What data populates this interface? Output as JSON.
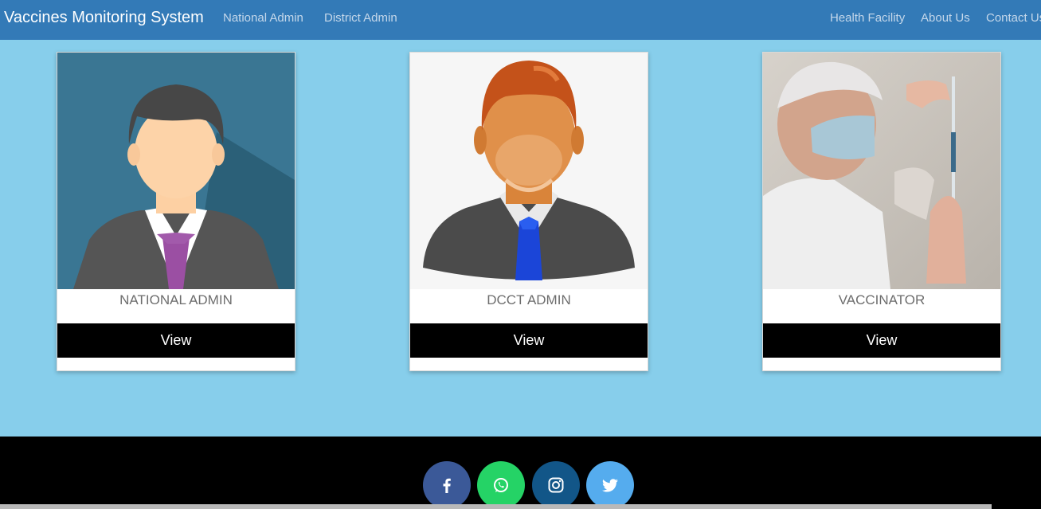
{
  "navbar": {
    "brand": "Vaccines Monitoring System",
    "left_links": [
      "National Admin",
      "District Admin"
    ],
    "right_links": [
      "Health Facility",
      "About Us",
      "Contact Us"
    ]
  },
  "cards": [
    {
      "title": "NATIONAL ADMIN",
      "button": "View",
      "image": "admin-avatar-illustration"
    },
    {
      "title": "DCCT ADMIN",
      "button": "View",
      "image": "dcct-admin-avatar-illustration"
    },
    {
      "title": "VACCINATOR",
      "button": "View",
      "image": "vaccinator-photo"
    }
  ],
  "footer": {
    "social": [
      {
        "icon": "facebook-icon",
        "color": "#3b5998"
      },
      {
        "icon": "whatsapp-icon",
        "color": "#25d366"
      },
      {
        "icon": "instagram-icon",
        "color": "#125688"
      },
      {
        "icon": "twitter-icon",
        "color": "#55acee"
      }
    ]
  },
  "colors": {
    "navbar": "#337ab7",
    "page_bg": "#87ceeb",
    "footer": "#000000",
    "button": "#000000"
  }
}
